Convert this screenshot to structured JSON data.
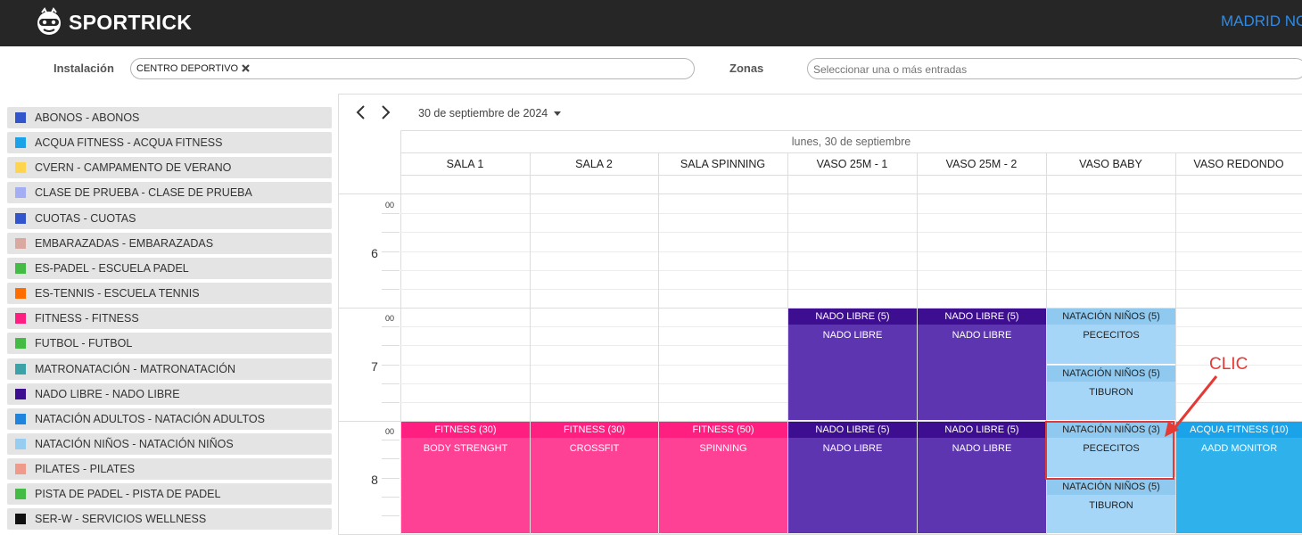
{
  "app": {
    "brand": "SPORTRICK",
    "location": "MADRID NO"
  },
  "filters": {
    "installation_label": "Instalación",
    "installation_tag": "CENTRO DEPORTIVO",
    "zones_label": "Zonas",
    "zones_placeholder": "Seleccionar una o más entradas"
  },
  "legend": [
    {
      "label": "ABONOS - ABONOS",
      "color": "#3355cc"
    },
    {
      "label": "ACQUA FITNESS - ACQUA FITNESS",
      "color": "#1aa3e8"
    },
    {
      "label": "CVERN - CAMPAMENTO DE VERANO",
      "color": "#ffd54f"
    },
    {
      "label": "CLASE DE PRUEBA - CLASE DE PRUEBA",
      "color": "#a3aef5"
    },
    {
      "label": "CUOTAS - CUOTAS",
      "color": "#3355cc"
    },
    {
      "label": "EMBARAZADAS - EMBARAZADAS",
      "color": "#d9a8a0"
    },
    {
      "label": "ES-PADEL - ESCUELA PADEL",
      "color": "#44bb44"
    },
    {
      "label": "ES-TENNIS - ESCUELA TENNIS",
      "color": "#ff6d00"
    },
    {
      "label": "FITNESS - FITNESS",
      "color": "#ff1f80"
    },
    {
      "label": "FUTBOL - FUTBOL",
      "color": "#44bb44"
    },
    {
      "label": "MATRONATACIÓN - MATRONATACIÓN",
      "color": "#3ba3a8"
    },
    {
      "label": "NADO LIBRE - NADO LIBRE",
      "color": "#3d0e8f"
    },
    {
      "label": "NATACIÓN ADULTOS - NATACIÓN ADULTOS",
      "color": "#1f84dd"
    },
    {
      "label": "NATACIÓN NIÑOS - NATACIÓN NIÑOS",
      "color": "#96cdf0"
    },
    {
      "label": "PILATES - PILATES",
      "color": "#ef9a8a"
    },
    {
      "label": "PISTA DE PADEL - PISTA DE PADEL",
      "color": "#44bb44"
    },
    {
      "label": "SER-W - SERVICIOS WELLNESS",
      "color": "#111111"
    }
  ],
  "calendar": {
    "date_label": "30 de septiembre de 2024",
    "day_header": "lunes, 30 de septiembre",
    "resources": [
      "SALA 1",
      "SALA 2",
      "SALA SPINNING",
      "VASO 25M - 1",
      "VASO 25M - 2",
      "VASO BABY",
      "VASO REDONDO"
    ],
    "hours": [
      {
        "hour": "6",
        "minutes": "00"
      },
      {
        "hour": "7",
        "minutes": "00"
      },
      {
        "hour": "8",
        "minutes": "00"
      }
    ],
    "events": [
      {
        "title": "NADO LIBRE (5)",
        "body": "NADO LIBRE",
        "col": 3,
        "start": 7.0,
        "end": 8.0,
        "title_color": "#3d0e8f",
        "body_color": "#5e35b1",
        "text_color": "#ffffff"
      },
      {
        "title": "NADO LIBRE (5)",
        "body": "NADO LIBRE",
        "col": 4,
        "start": 7.0,
        "end": 8.0,
        "title_color": "#3d0e8f",
        "body_color": "#5e35b1",
        "text_color": "#ffffff"
      },
      {
        "title": "NATACIÓN NIÑOS (5)",
        "body": "PECECITOS",
        "col": 5,
        "start": 7.0,
        "end": 7.5,
        "title_color": "#8fc9ef",
        "body_color": "#a6d6f7",
        "text_color": "#222222"
      },
      {
        "title": "NATACIÓN NIÑOS (5)",
        "body": "TIBURON",
        "col": 5,
        "start": 7.5,
        "end": 8.0,
        "title_color": "#8fc9ef",
        "body_color": "#a6d6f7",
        "text_color": "#222222"
      },
      {
        "title": "FITNESS (30)",
        "body": "BODY STRENGHT",
        "col": 0,
        "start": 8.0,
        "end": 9.0,
        "title_color": "#ff1f80",
        "body_color": "#ff4196",
        "text_color": "#ffffff"
      },
      {
        "title": "FITNESS (30)",
        "body": "CROSSFIT",
        "col": 1,
        "start": 8.0,
        "end": 9.0,
        "title_color": "#ff1f80",
        "body_color": "#ff4196",
        "text_color": "#ffffff"
      },
      {
        "title": "FITNESS (50)",
        "body": "SPINNING",
        "col": 2,
        "start": 8.0,
        "end": 9.0,
        "title_color": "#ff1f80",
        "body_color": "#ff4196",
        "text_color": "#ffffff"
      },
      {
        "title": "NADO LIBRE (5)",
        "body": "NADO LIBRE",
        "col": 3,
        "start": 8.0,
        "end": 9.0,
        "title_color": "#3d0e8f",
        "body_color": "#5e35b1",
        "text_color": "#ffffff"
      },
      {
        "title": "NADO LIBRE (5)",
        "body": "NADO LIBRE",
        "col": 4,
        "start": 8.0,
        "end": 9.0,
        "title_color": "#3d0e8f",
        "body_color": "#5e35b1",
        "text_color": "#ffffff"
      },
      {
        "title": "NATACIÓN NIÑOS (3)",
        "body": "PECECITOS",
        "col": 5,
        "start": 8.0,
        "end": 8.5,
        "title_color": "#8fc9ef",
        "body_color": "#a6d6f7",
        "text_color": "#222222"
      },
      {
        "title": "NATACIÓN NIÑOS (5)",
        "body": "TIBURON",
        "col": 5,
        "start": 8.5,
        "end": 9.0,
        "title_color": "#8fc9ef",
        "body_color": "#a6d6f7",
        "text_color": "#222222"
      },
      {
        "title": "ACQUA FITNESS (10)",
        "body": "AADD MONITOR",
        "col": 6,
        "start": 8.0,
        "end": 9.0,
        "title_color": "#1aa3e8",
        "body_color": "#2fb2ec",
        "text_color": "#ffffff"
      }
    ]
  },
  "annotation": {
    "label": "CLIC",
    "color": "#e53935"
  }
}
